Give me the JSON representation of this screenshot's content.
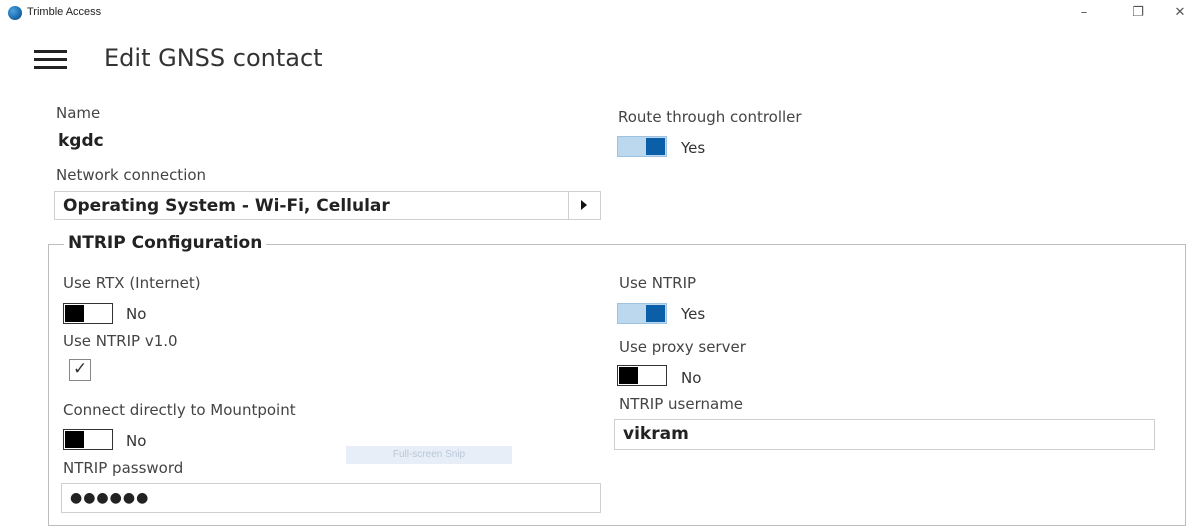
{
  "window": {
    "title": "Trimble Access",
    "minimize": "–",
    "maximize": "❐",
    "close": "✕"
  },
  "header": {
    "title": "Edit GNSS contact"
  },
  "form": {
    "name_label": "Name",
    "name_value": "kgdc",
    "route_label": "Route through controller",
    "route_value": "Yes",
    "route_on": true,
    "network_label": "Network connection",
    "network_value": "Operating System - Wi-Fi, Cellular"
  },
  "ntrip": {
    "group_title": "NTRIP Configuration",
    "use_rtx_label": "Use RTX (Internet)",
    "use_rtx_value": "No",
    "use_rtx_on": false,
    "use_ntrip_v1_label": "Use NTRIP v1.0",
    "use_ntrip_v1_checked": true,
    "connect_mountpoint_label": "Connect directly to Mountpoint",
    "connect_mountpoint_value": "No",
    "connect_mountpoint_on": false,
    "password_label": "NTRIP password",
    "password_value": "●●●●●●",
    "use_ntrip_label": "Use NTRIP",
    "use_ntrip_value": "Yes",
    "use_ntrip_on": true,
    "use_proxy_label": "Use proxy server",
    "use_proxy_value": "No",
    "use_proxy_on": false,
    "username_label": "NTRIP username",
    "username_value": "vikram"
  },
  "overlay": {
    "snip_text": "Full-screen Snip"
  },
  "colors": {
    "accent": "#0a5fa8",
    "toggle_on_track": "#bcd8ee",
    "toggle_off_knob": "#000000"
  }
}
